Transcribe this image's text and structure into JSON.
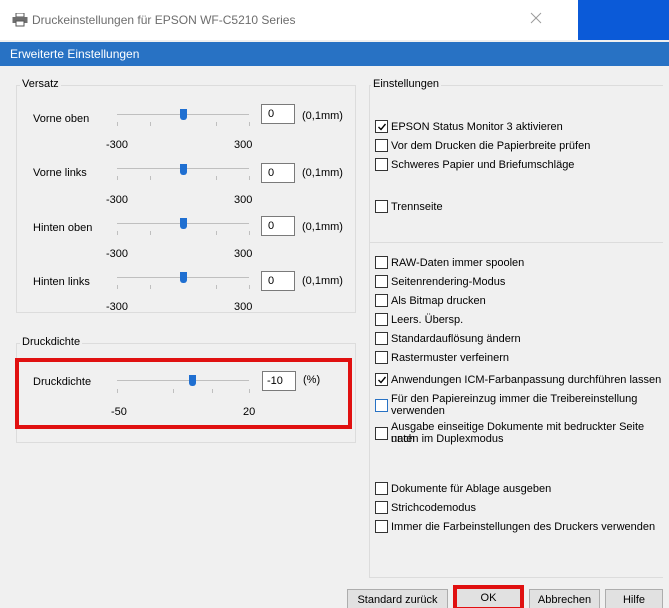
{
  "window": {
    "title": "Druckeinstellungen für EPSON WF-C5210 Series",
    "section_header": "Erweiterte Einstellungen"
  },
  "offset_group": {
    "label": "Versatz",
    "unit": "(0,1mm)",
    "rows": [
      {
        "label": "Vorne oben",
        "value": "0",
        "min": "-300",
        "max": "300",
        "level": 0
      },
      {
        "label": "Vorne links",
        "value": "0",
        "min": "-300",
        "max": "300",
        "level": 0
      },
      {
        "label": "Hinten oben",
        "value": "0",
        "min": "-300",
        "max": "300",
        "level": 0
      },
      {
        "label": "Hinten links",
        "value": "0",
        "min": "-300",
        "max": "300",
        "level": 0
      }
    ]
  },
  "density_group": {
    "label": "Druckdichte",
    "row_label": "Druckdichte",
    "value": "-10",
    "unit": "(%)",
    "min": "-50",
    "max": "20",
    "level": -10
  },
  "settings_group": {
    "label": "Einstellungen",
    "items": [
      {
        "label": "EPSON Status Monitor 3 aktivieren",
        "checked": true
      },
      {
        "label": "Vor dem Drucken die Papierbreite prüfen",
        "checked": false
      },
      {
        "label": "Schweres Papier und Briefumschläge",
        "checked": false
      },
      {
        "label": "Trennseite",
        "checked": false
      },
      {
        "label": "RAW-Daten immer spoolen",
        "checked": false
      },
      {
        "label": "Seitenrendering-Modus",
        "checked": false
      },
      {
        "label": "Als Bitmap drucken",
        "checked": false
      },
      {
        "label": "Leers. Übersp.",
        "checked": false
      },
      {
        "label": "Standardauflösung ändern",
        "checked": false
      },
      {
        "label": "Rastermuster verfeinern",
        "checked": false
      },
      {
        "label": "Anwendungen ICM-Farbanpassung durchführen lassen",
        "checked": true
      },
      {
        "label_line1": "Für den Papiereinzug immer die Treibereinstellung",
        "label_line2": "verwenden",
        "checked": false
      },
      {
        "label_line1": "Ausgabe einseitige Dokumente mit bedruckter Seite nach",
        "label_line2": "unten im Duplexmodus",
        "checked": false
      },
      {
        "label": "Dokumente für Ablage ausgeben",
        "checked": false
      },
      {
        "label": "Strichcodemodus",
        "checked": false
      },
      {
        "label": "Immer die Farbeinstellungen des Druckers verwenden",
        "checked": false
      }
    ]
  },
  "buttons": {
    "reset": "Standard zurück",
    "ok": "OK",
    "cancel": "Abbrechen",
    "help": "Hilfe"
  },
  "colors": {
    "accent": "#2872c4",
    "highlight": "#e01010"
  }
}
